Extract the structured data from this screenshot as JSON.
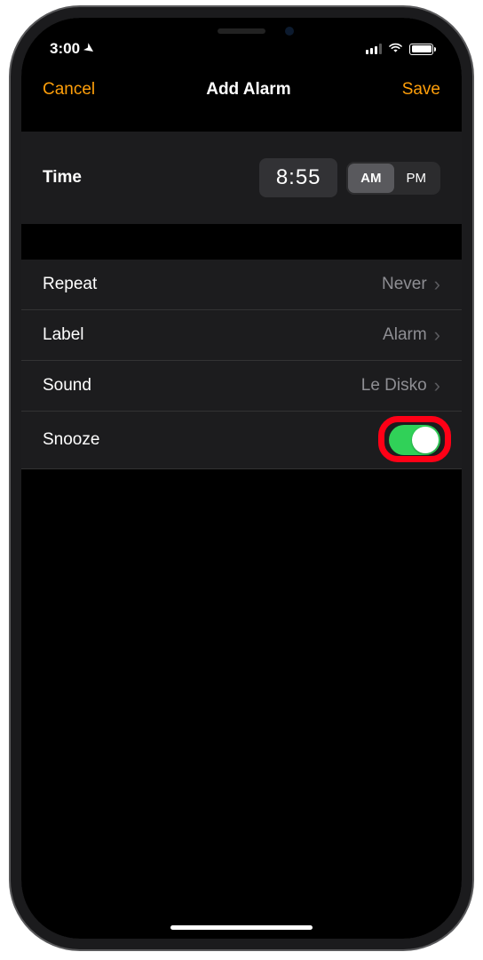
{
  "status": {
    "time": "3:00",
    "location_active": true
  },
  "nav": {
    "cancel": "Cancel",
    "title": "Add Alarm",
    "save": "Save"
  },
  "time_row": {
    "label": "Time",
    "value": "8:55",
    "am": "AM",
    "pm": "PM",
    "selected": "AM"
  },
  "rows": {
    "repeat": {
      "label": "Repeat",
      "value": "Never"
    },
    "label": {
      "label": "Label",
      "value": "Alarm"
    },
    "sound": {
      "label": "Sound",
      "value": "Le Disko"
    },
    "snooze": {
      "label": "Snooze",
      "on": true
    }
  },
  "highlight_color": "#ff0016",
  "accent_color": "#ff9f0a",
  "switch_on_color": "#30d158"
}
